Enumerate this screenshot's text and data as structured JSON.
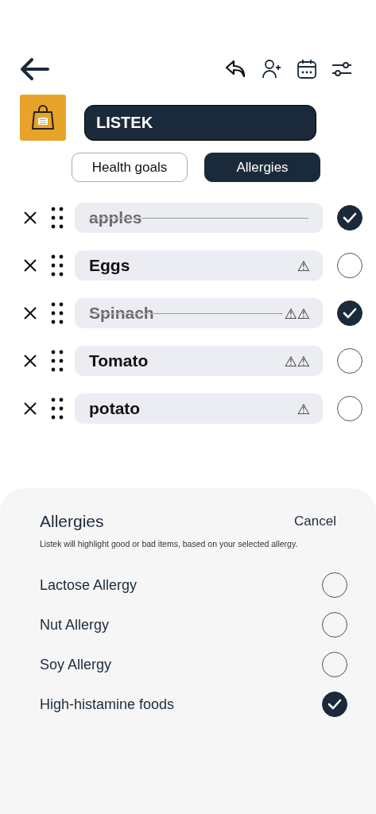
{
  "header": {
    "title": "LISTEK"
  },
  "tabs": [
    {
      "label": "Health goals",
      "selected": false
    },
    {
      "label": "Allergies",
      "selected": true
    }
  ],
  "items": [
    {
      "name": "apples",
      "checked": true
    },
    {
      "name": "Eggs",
      "checked": false,
      "warnings": "⚠"
    },
    {
      "name": "Spinach",
      "checked": true,
      "warnings": "⚠⚠"
    },
    {
      "name": "Tomato",
      "checked": false,
      "warnings": "⚠⚠"
    },
    {
      "name": "potato",
      "checked": false,
      "warnings": "⚠"
    }
  ],
  "sheet": {
    "title": "Allergies",
    "cancel": "Cancel",
    "description": "Listek will highlight good or bad items, based on your selected allergy.",
    "options": [
      {
        "label": "Lactose Allergy",
        "checked": false
      },
      {
        "label": "Nut Allergy",
        "checked": false
      },
      {
        "label": "Soy Allergy",
        "checked": false
      },
      {
        "label": "High-histamine foods",
        "checked": true
      }
    ]
  }
}
